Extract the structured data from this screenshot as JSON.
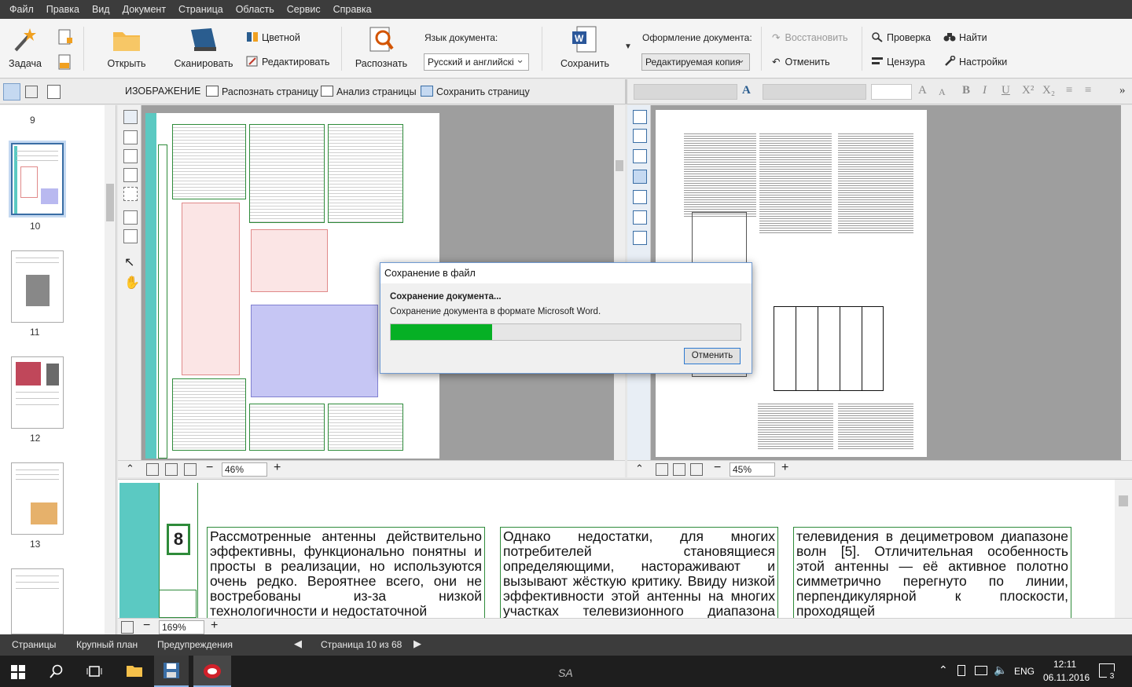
{
  "menu": [
    "Файл",
    "Правка",
    "Вид",
    "Документ",
    "Страница",
    "Область",
    "Сервис",
    "Справка"
  ],
  "ribbon": {
    "task": "Задача",
    "open": "Открыть",
    "scan": "Сканировать",
    "color": "Цветной",
    "edit": "Редактировать",
    "recognize": "Распознать",
    "lang_label": "Язык документа:",
    "lang_value": "Русский и английскі",
    "save": "Сохранить",
    "format_label": "Оформление документа:",
    "format_value": "Редактируемая копия",
    "restore": "Восстановить",
    "undo": "Отменить",
    "check": "Проверка",
    "censor": "Цензура",
    "find": "Найти",
    "settings": "Настройки"
  },
  "imagebar": {
    "title": "ИЗОБРАЖЕНИЕ",
    "recognize_page": "Распознать страницу",
    "analyze_page": "Анализ страницы",
    "save_page": "Сохранить страницу"
  },
  "thumbnails": [
    "9",
    "10",
    "11",
    "12",
    "13"
  ],
  "image_zoom": "46%",
  "text_zoom": "45%",
  "zoom_zoom": "169%",
  "zoom_text": {
    "page_number": "8",
    "col1": "Рассмотренные антенны действительно эффективны, функционально понятны и просты в реализации, но используются очень редко. Вероятнее всего, они не востребованы из-за низкой технологичности и недостаточной",
    "col2": "Однако недостатки, для многих потребителей становящиеся определяющими, настораживают и вызывают жёсткую критику. Ввиду низкой эффективности этой антенны на многих участках телевизионного диапазона частот",
    "col3": "телевидения в дециметровом диапазоне волн [5]. Отличительная особенность этой антенны — её активное полотно симметрично перегнуто по линии, перпендикулярной к плоскости, проходящей"
  },
  "bottom": {
    "pages": "Страницы",
    "zoom": "Крупный план",
    "warnings": "Предупреждения",
    "page_info": "Страница 10 из 68"
  },
  "taskbar": {
    "lang": "ENG",
    "time": "12:11",
    "date": "06.11.2016",
    "notif": "3",
    "center": "SA"
  },
  "dialog": {
    "title": "Сохранение в файл",
    "heading": "Сохранение документа...",
    "message": "Сохранение документа в формате Microsoft Word.",
    "progress": 0.29,
    "cancel": "Отменить"
  },
  "colors": {
    "accent": "#3a6ea5",
    "progress": "#06b025",
    "green_border": "#2e8b3a",
    "teal": "#5bc9c2"
  }
}
